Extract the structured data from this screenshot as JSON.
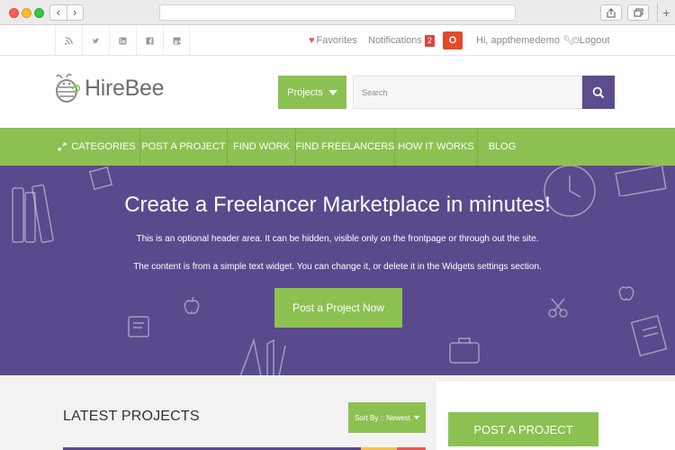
{
  "topbar": {
    "social_icons": [
      "rss-icon",
      "twitter-icon",
      "linkedin-icon",
      "facebook-icon",
      "google-plus-icon"
    ],
    "favorites_label": "Favorites",
    "notifications_label": "Notifications",
    "notifications_count": "2",
    "greeting": "Hi, appthemedemo",
    "logout_label": "Logout"
  },
  "header": {
    "logo_text": "HireBee",
    "projects_button": "Projects",
    "search_placeholder": "Search"
  },
  "nav": {
    "items": [
      "CATEGORIES",
      "POST A PROJECT",
      "FIND WORK",
      "FIND FREELANCERS",
      "HOW IT WORKS",
      "BLOG"
    ]
  },
  "hero": {
    "title": "Create a Freelancer Marketplace in minutes!",
    "line1": "This is an optional header area. It can be hidden, visible only on the frontpage or through out the site.",
    "line2": "The content is from a simple text widget. You can change it, or delete it in the Widgets settings section.",
    "cta_label": "Post a Project Now"
  },
  "main": {
    "latest_title": "LATEST PROJECTS",
    "sort_label": "Sort By :: Newest"
  },
  "sidebar": {
    "post_button": "POST A PROJECT"
  },
  "colors": {
    "accent_green": "#8cc152",
    "purple": "#594a8d",
    "badge_red": "#e04343"
  }
}
